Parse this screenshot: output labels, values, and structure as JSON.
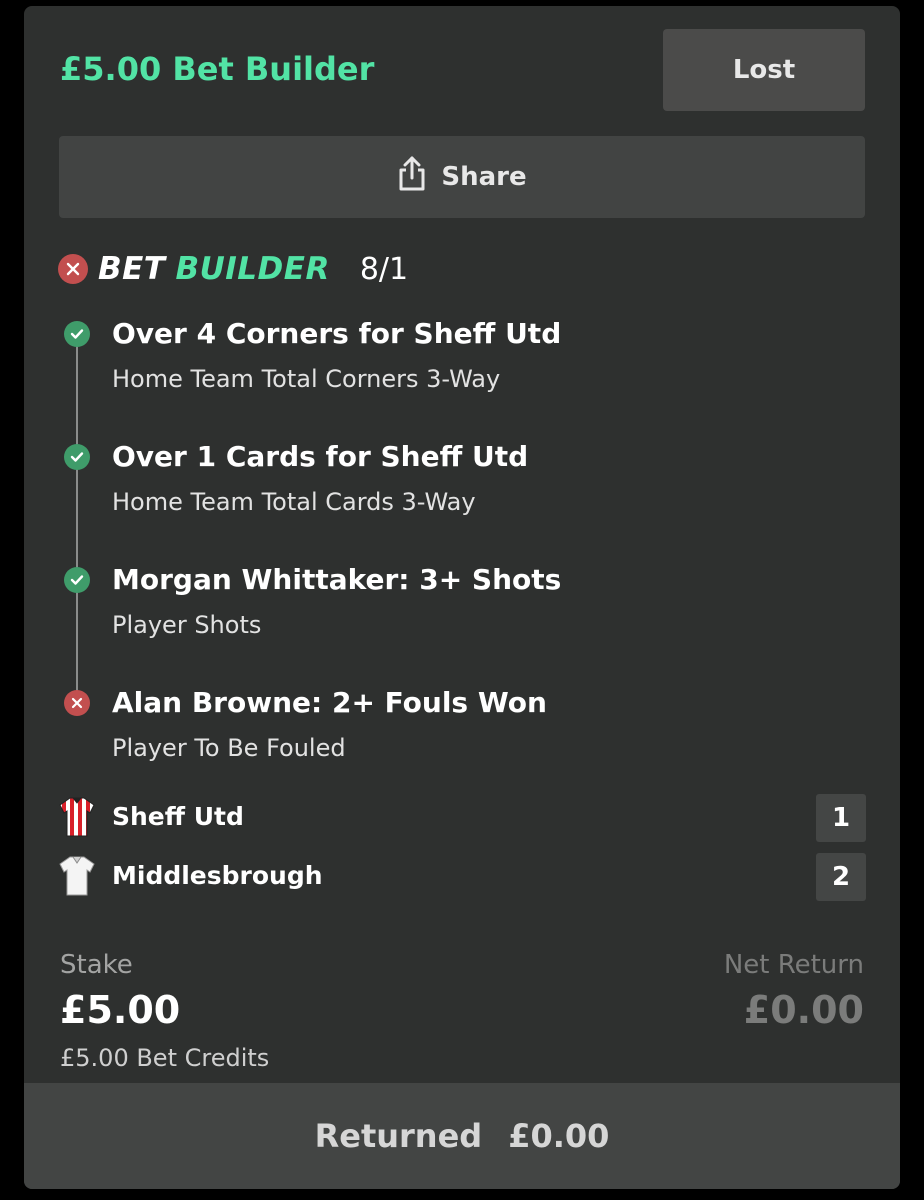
{
  "bet": {
    "title": "£5.00 Bet Builder",
    "status_label": "Lost",
    "share_label": "Share"
  },
  "bet_builder": {
    "word1": "BET",
    "word2": "BUILDER",
    "odds": "8/1",
    "result": "lost"
  },
  "legs": [
    {
      "name": "Over 4 Corners for Sheff Utd",
      "market": "Home Team Total Corners 3-Way",
      "result": "won"
    },
    {
      "name": "Over 1 Cards for Sheff Utd",
      "market": "Home Team Total Cards 3-Way",
      "result": "won"
    },
    {
      "name": "Morgan Whittaker: 3+ Shots",
      "market": "Player Shots",
      "result": "won"
    },
    {
      "name": "Alan Browne: 2+ Fouls Won",
      "market": "Player To Be Fouled",
      "result": "lost"
    }
  ],
  "teams": [
    {
      "name": "Sheff Utd",
      "score": "1",
      "shirt": "red-white-stripes-shirt-icon"
    },
    {
      "name": "Middlesbrough",
      "score": "2",
      "shirt": "white-shirt-icon"
    }
  ],
  "stake": {
    "label": "Stake",
    "amount": "£5.00",
    "note": "£5.00 Bet Credits"
  },
  "net_return": {
    "label": "Net Return",
    "amount": "£0.00"
  },
  "footer": {
    "label": "Returned",
    "amount": "£0.00"
  },
  "colors": {
    "accent": "#52e3a5",
    "won": "#3f9c6a",
    "lost": "#c24f4f",
    "card_bg": "#2e302f"
  }
}
